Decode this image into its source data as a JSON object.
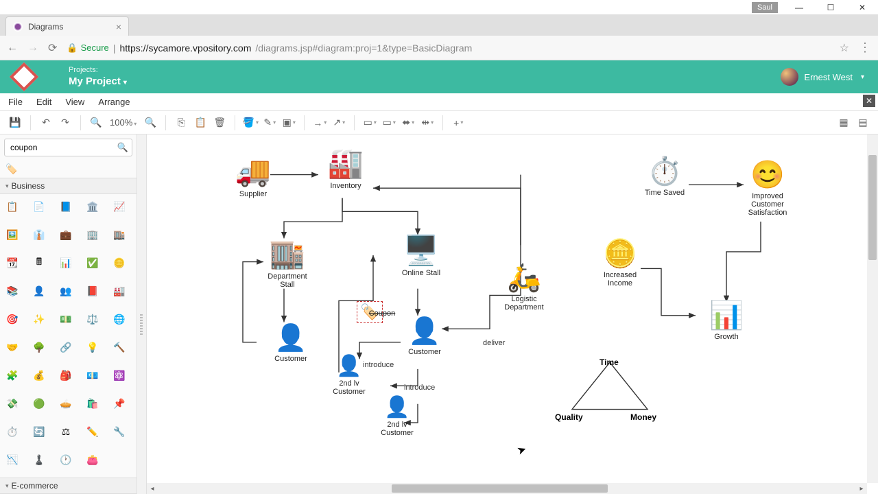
{
  "window": {
    "os_user": "Saul"
  },
  "browser": {
    "tab_title": "Diagrams",
    "secure_label": "Secure",
    "url_host": "https://sycamore.vpository.com",
    "url_path": "/diagrams.jsp#diagram:proj=1&type=BasicDiagram"
  },
  "header": {
    "projects_label": "Projects:",
    "project_name": "My Project",
    "user_name": "Ernest West"
  },
  "menubar": {
    "items": [
      "File",
      "Edit",
      "View",
      "Arrange"
    ]
  },
  "toolbar": {
    "zoom": "100%"
  },
  "sidebar": {
    "search_value": "coupon",
    "categories": {
      "business": "Business",
      "ecommerce": "E-commerce"
    }
  },
  "diagram": {
    "nodes": {
      "supplier": "Supplier",
      "inventory": "Inventory",
      "dept_stall": "Department\nStall",
      "online_stall": "Online Stall",
      "coupon": "Coupon",
      "logistic": "Logistic\nDepartment",
      "customer1": "Customer",
      "customer2": "Customer",
      "second_lv_1": "2nd lv\nCustomer",
      "second_lv_2": "2nd lv\nCustomer",
      "time_saved": "Time Saved",
      "improved": "Improved\nCustomer\nSatisfaction",
      "increased": "Increased\nIncome",
      "growth": "Growth"
    },
    "edge_labels": {
      "deliver": "deliver",
      "introduce1": "introduce",
      "introduce2": "introduce"
    },
    "triangle": {
      "top": "Time",
      "left": "Quality",
      "right": "Money"
    }
  }
}
